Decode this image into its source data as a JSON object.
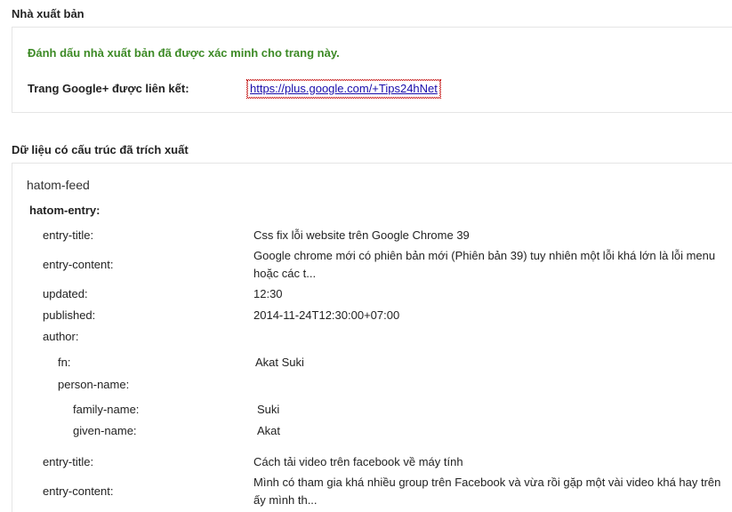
{
  "publisher": {
    "heading": "Nhà xuất bản",
    "verified_message": "Đánh dấu nhà xuất bản đã được xác minh cho trang này.",
    "linked_label": "Trang Google+ được liên kết:",
    "linked_url": "https://plus.google.com/+Tips24hNet"
  },
  "structured_data": {
    "heading": "Dữ liệu có cấu trúc đã trích xuất",
    "feed_type": "hatom-feed",
    "entry_type": "hatom-entry:",
    "entry1": {
      "title_label": "entry-title:",
      "title_value": "Css fix lỗi website trên Google Chrome 39",
      "content_label": "entry-content:",
      "content_line1": "Google chrome mới có phiên bản mới (Phiên bản 39) tuy nhiên một lỗi khá lớn là lỗi menu",
      "content_line2": "hoặc các t...",
      "updated_label": "updated:",
      "updated_value": "12:30",
      "published_label": "published:",
      "published_value": "2014-11-24T12:30:00+07:00",
      "author_label": "author:",
      "fn_label": "fn:",
      "fn_value": "Akat Suki",
      "person_name_label": "person-name:",
      "family_name_label": "family-name:",
      "family_name_value": "Suki",
      "given_name_label": "given-name:",
      "given_name_value": "Akat"
    },
    "entry2": {
      "title_label": "entry-title:",
      "title_value": "Cách tải video trên facebook về máy tính",
      "content_label": "entry-content:",
      "content_line1": "Mình có tham gia khá nhiều group trên Facebook và vừa rồi gặp một vài video khá hay trên",
      "content_line2": "ấy mình th..."
    }
  }
}
